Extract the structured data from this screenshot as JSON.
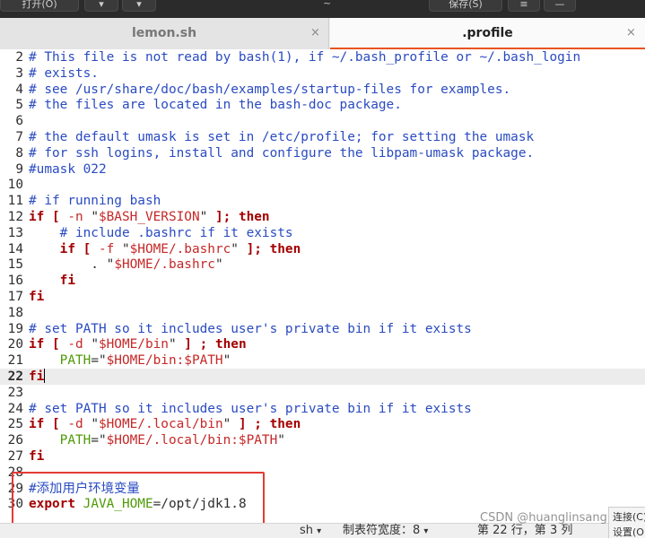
{
  "window": {
    "title": "~",
    "header_buttons": [
      "打开(O)",
      "▾",
      "▾",
      "保存(S)",
      "≡",
      "—"
    ]
  },
  "tabs": [
    {
      "label": "lemon.sh",
      "close": "×",
      "active": false
    },
    {
      "label": ".profile",
      "close": "×",
      "active": true
    }
  ],
  "editor": {
    "lines": [
      {
        "n": "2",
        "parts": [
          [
            "com",
            "# This file is not read by bash(1), if ~/.bash_profile or ~/.bash_login"
          ]
        ]
      },
      {
        "n": "3",
        "parts": [
          [
            "com",
            "# exists."
          ]
        ]
      },
      {
        "n": "4",
        "parts": [
          [
            "com",
            "# see /usr/share/doc/bash/examples/startup-files for examples."
          ]
        ]
      },
      {
        "n": "5",
        "parts": [
          [
            "com",
            "# the files are located in the bash-doc package."
          ]
        ]
      },
      {
        "n": "6",
        "parts": []
      },
      {
        "n": "7",
        "parts": [
          [
            "com",
            "# the default umask is set in /etc/profile; for setting the umask"
          ]
        ]
      },
      {
        "n": "8",
        "parts": [
          [
            "com",
            "# for ssh logins, install and configure the libpam-umask package."
          ]
        ]
      },
      {
        "n": "9",
        "parts": [
          [
            "com",
            "#umask 022"
          ]
        ]
      },
      {
        "n": "10",
        "parts": []
      },
      {
        "n": "11",
        "parts": [
          [
            "com",
            "# if running bash"
          ]
        ]
      },
      {
        "n": "12",
        "parts": [
          [
            "kw",
            "if [ "
          ],
          [
            "str",
            "-n"
          ],
          [
            "pl",
            " \""
          ],
          [
            "str",
            "$BASH_VERSION"
          ],
          [
            "pl",
            "\" "
          ],
          [
            "kw",
            "]; then"
          ]
        ]
      },
      {
        "n": "13",
        "parts": [
          [
            "com",
            "    # include .bashrc if it exists"
          ]
        ]
      },
      {
        "n": "14",
        "parts": [
          [
            "pl",
            "    "
          ],
          [
            "kw",
            "if [ "
          ],
          [
            "str",
            "-f"
          ],
          [
            "pl",
            " \""
          ],
          [
            "str",
            "$HOME/.bashrc"
          ],
          [
            "pl",
            "\" "
          ],
          [
            "kw",
            "]; then"
          ]
        ]
      },
      {
        "n": "15",
        "parts": [
          [
            "pl",
            "        . \""
          ],
          [
            "str",
            "$HOME/.bashrc"
          ],
          [
            "pl",
            "\""
          ]
        ]
      },
      {
        "n": "16",
        "parts": [
          [
            "pl",
            "    "
          ],
          [
            "kw",
            "fi"
          ]
        ]
      },
      {
        "n": "17",
        "parts": [
          [
            "kw",
            "fi"
          ]
        ]
      },
      {
        "n": "18",
        "parts": []
      },
      {
        "n": "19",
        "parts": [
          [
            "com",
            "# set PATH so it includes user's private bin if it exists"
          ]
        ]
      },
      {
        "n": "20",
        "parts": [
          [
            "kw",
            "if [ "
          ],
          [
            "str",
            "-d"
          ],
          [
            "pl",
            " \""
          ],
          [
            "str",
            "$HOME/bin"
          ],
          [
            "pl",
            "\" "
          ],
          [
            "kw",
            "] ; then"
          ]
        ]
      },
      {
        "n": "21",
        "parts": [
          [
            "pl",
            "    "
          ],
          [
            "var",
            "PATH"
          ],
          [
            "pl",
            "=\""
          ],
          [
            "str",
            "$HOME/bin:$PATH"
          ],
          [
            "pl",
            "\""
          ]
        ]
      },
      {
        "n": "22",
        "parts": [
          [
            "kw",
            "fi"
          ]
        ],
        "current": true
      },
      {
        "n": "23",
        "parts": []
      },
      {
        "n": "24",
        "parts": [
          [
            "com",
            "# set PATH so it includes user's private bin if it exists"
          ]
        ]
      },
      {
        "n": "25",
        "parts": [
          [
            "kw",
            "if [ "
          ],
          [
            "str",
            "-d"
          ],
          [
            "pl",
            " \""
          ],
          [
            "str",
            "$HOME/.local/bin"
          ],
          [
            "pl",
            "\" "
          ],
          [
            "kw",
            "] ; then"
          ]
        ]
      },
      {
        "n": "26",
        "parts": [
          [
            "pl",
            "    "
          ],
          [
            "var",
            "PATH"
          ],
          [
            "pl",
            "=\""
          ],
          [
            "str",
            "$HOME/.local/bin:$PATH"
          ],
          [
            "pl",
            "\""
          ]
        ]
      },
      {
        "n": "27",
        "parts": [
          [
            "kw",
            "fi"
          ]
        ]
      },
      {
        "n": "28",
        "parts": []
      },
      {
        "n": "29",
        "parts": [
          [
            "com",
            "#添加用户环境变量"
          ]
        ]
      },
      {
        "n": "30",
        "parts": [
          [
            "kw",
            "export "
          ],
          [
            "var",
            "JAVA_HOME"
          ],
          [
            "pl",
            "=/opt/jdk1.8"
          ]
        ]
      }
    ]
  },
  "statusbar": {
    "language": "sh",
    "tab_width": "制表符宽度：8",
    "position": "第 22 行，第 3 列",
    "caret": "▾"
  },
  "watermark": "CSDN @huanglinsang",
  "side_popup": {
    "line1": "连接(C)",
    "line2": "设置(O)"
  }
}
